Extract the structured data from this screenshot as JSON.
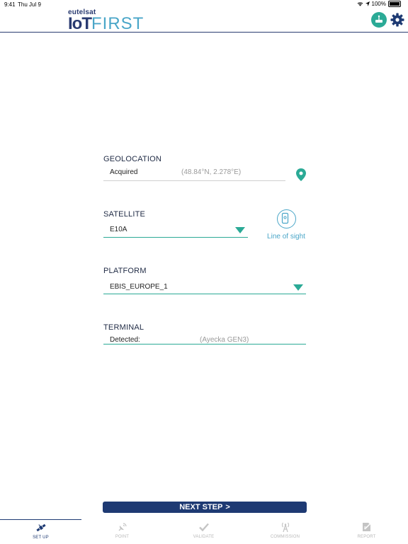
{
  "status_bar": {
    "time": "9:41",
    "date": "Thu Jul 9",
    "battery": "100%"
  },
  "header": {
    "brand_small": "eutelsat",
    "brand_iot": "IoT",
    "brand_first": "FIRST"
  },
  "geolocation": {
    "title": "GEOLOCATION",
    "status": "Acquired",
    "coords": "(48.84°N, 2.278°E)"
  },
  "satellite": {
    "title": "SATELLITE",
    "selected": "E10A",
    "line_of_sight_label": "Line of sight"
  },
  "platform": {
    "title": "PLATFORM",
    "selected": "EBIS_EUROPE_1"
  },
  "terminal": {
    "title": "TERMINAL",
    "status": "Detected:",
    "model": "(Ayecka GEN3)"
  },
  "next_step": {
    "label": "NEXT STEP",
    "arrow": ">"
  },
  "tabs": [
    {
      "label": "SET UP",
      "icon": "satellite-icon",
      "active": true
    },
    {
      "label": "POINT",
      "icon": "signal-dish-icon",
      "active": false
    },
    {
      "label": "VALIDATE",
      "icon": "checkmark-icon",
      "active": false
    },
    {
      "label": "COMMISSION",
      "icon": "antenna-icon",
      "active": false
    },
    {
      "label": "REPORT",
      "icon": "report-icon",
      "active": false
    }
  ],
  "colors": {
    "navy": "#1e3a73",
    "teal": "#2baa96",
    "blue": "#4aa6c8"
  }
}
